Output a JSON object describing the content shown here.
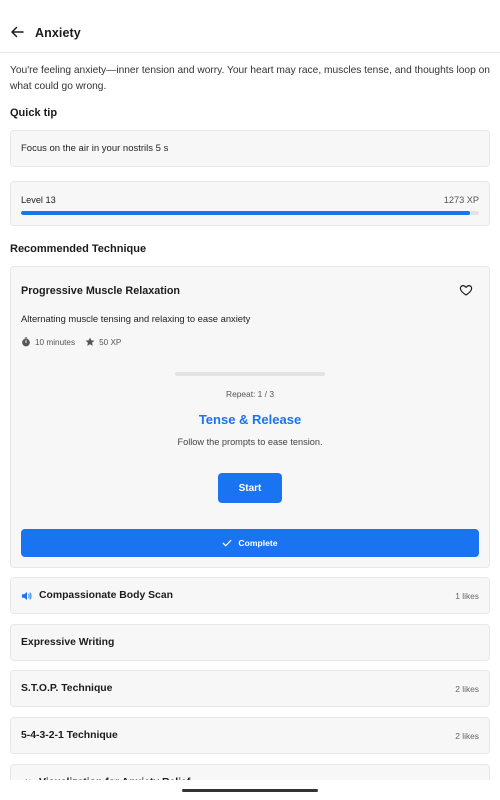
{
  "header": {
    "title": "Anxiety"
  },
  "description": "You're feeling anxiety—inner tension and worry. Your heart may race, muscles tense, and thoughts loop on what could go wrong.",
  "quick_tip": {
    "heading": "Quick tip",
    "text": "Focus on the air in your nostrils 5 s"
  },
  "level": {
    "label": "Level 13",
    "xp": "1273 XP",
    "progress": 0.98
  },
  "recommended": {
    "heading": "Recommended Technique",
    "title": "Progressive Muscle Relaxation",
    "description": "Alternating muscle tensing and relaxing to ease anxiety",
    "duration": "10 minutes",
    "xp": "50 XP",
    "repeat": "Repeat: 1 / 3",
    "exercise_name": "Tense & Release",
    "exercise_hint": "Follow the prompts to ease tension.",
    "start_label": "Start",
    "complete_label": "Complete"
  },
  "techniques": [
    {
      "label": "Compassionate Body Scan",
      "likes": "1 likes",
      "icon": "speaker-icon"
    },
    {
      "label": "Expressive Writing",
      "likes": ""
    },
    {
      "label": "S.T.O.P. Technique",
      "likes": "2 likes"
    },
    {
      "label": "5-4-3-2-1 Technique",
      "likes": "2 likes"
    },
    {
      "label": "Visualization for Anxiety Relief",
      "likes": "",
      "icon": "speaker-icon"
    }
  ],
  "colors": {
    "accent": "#1a73f0",
    "card_bg": "#f7f7f7",
    "track": "#e3e3e3"
  }
}
